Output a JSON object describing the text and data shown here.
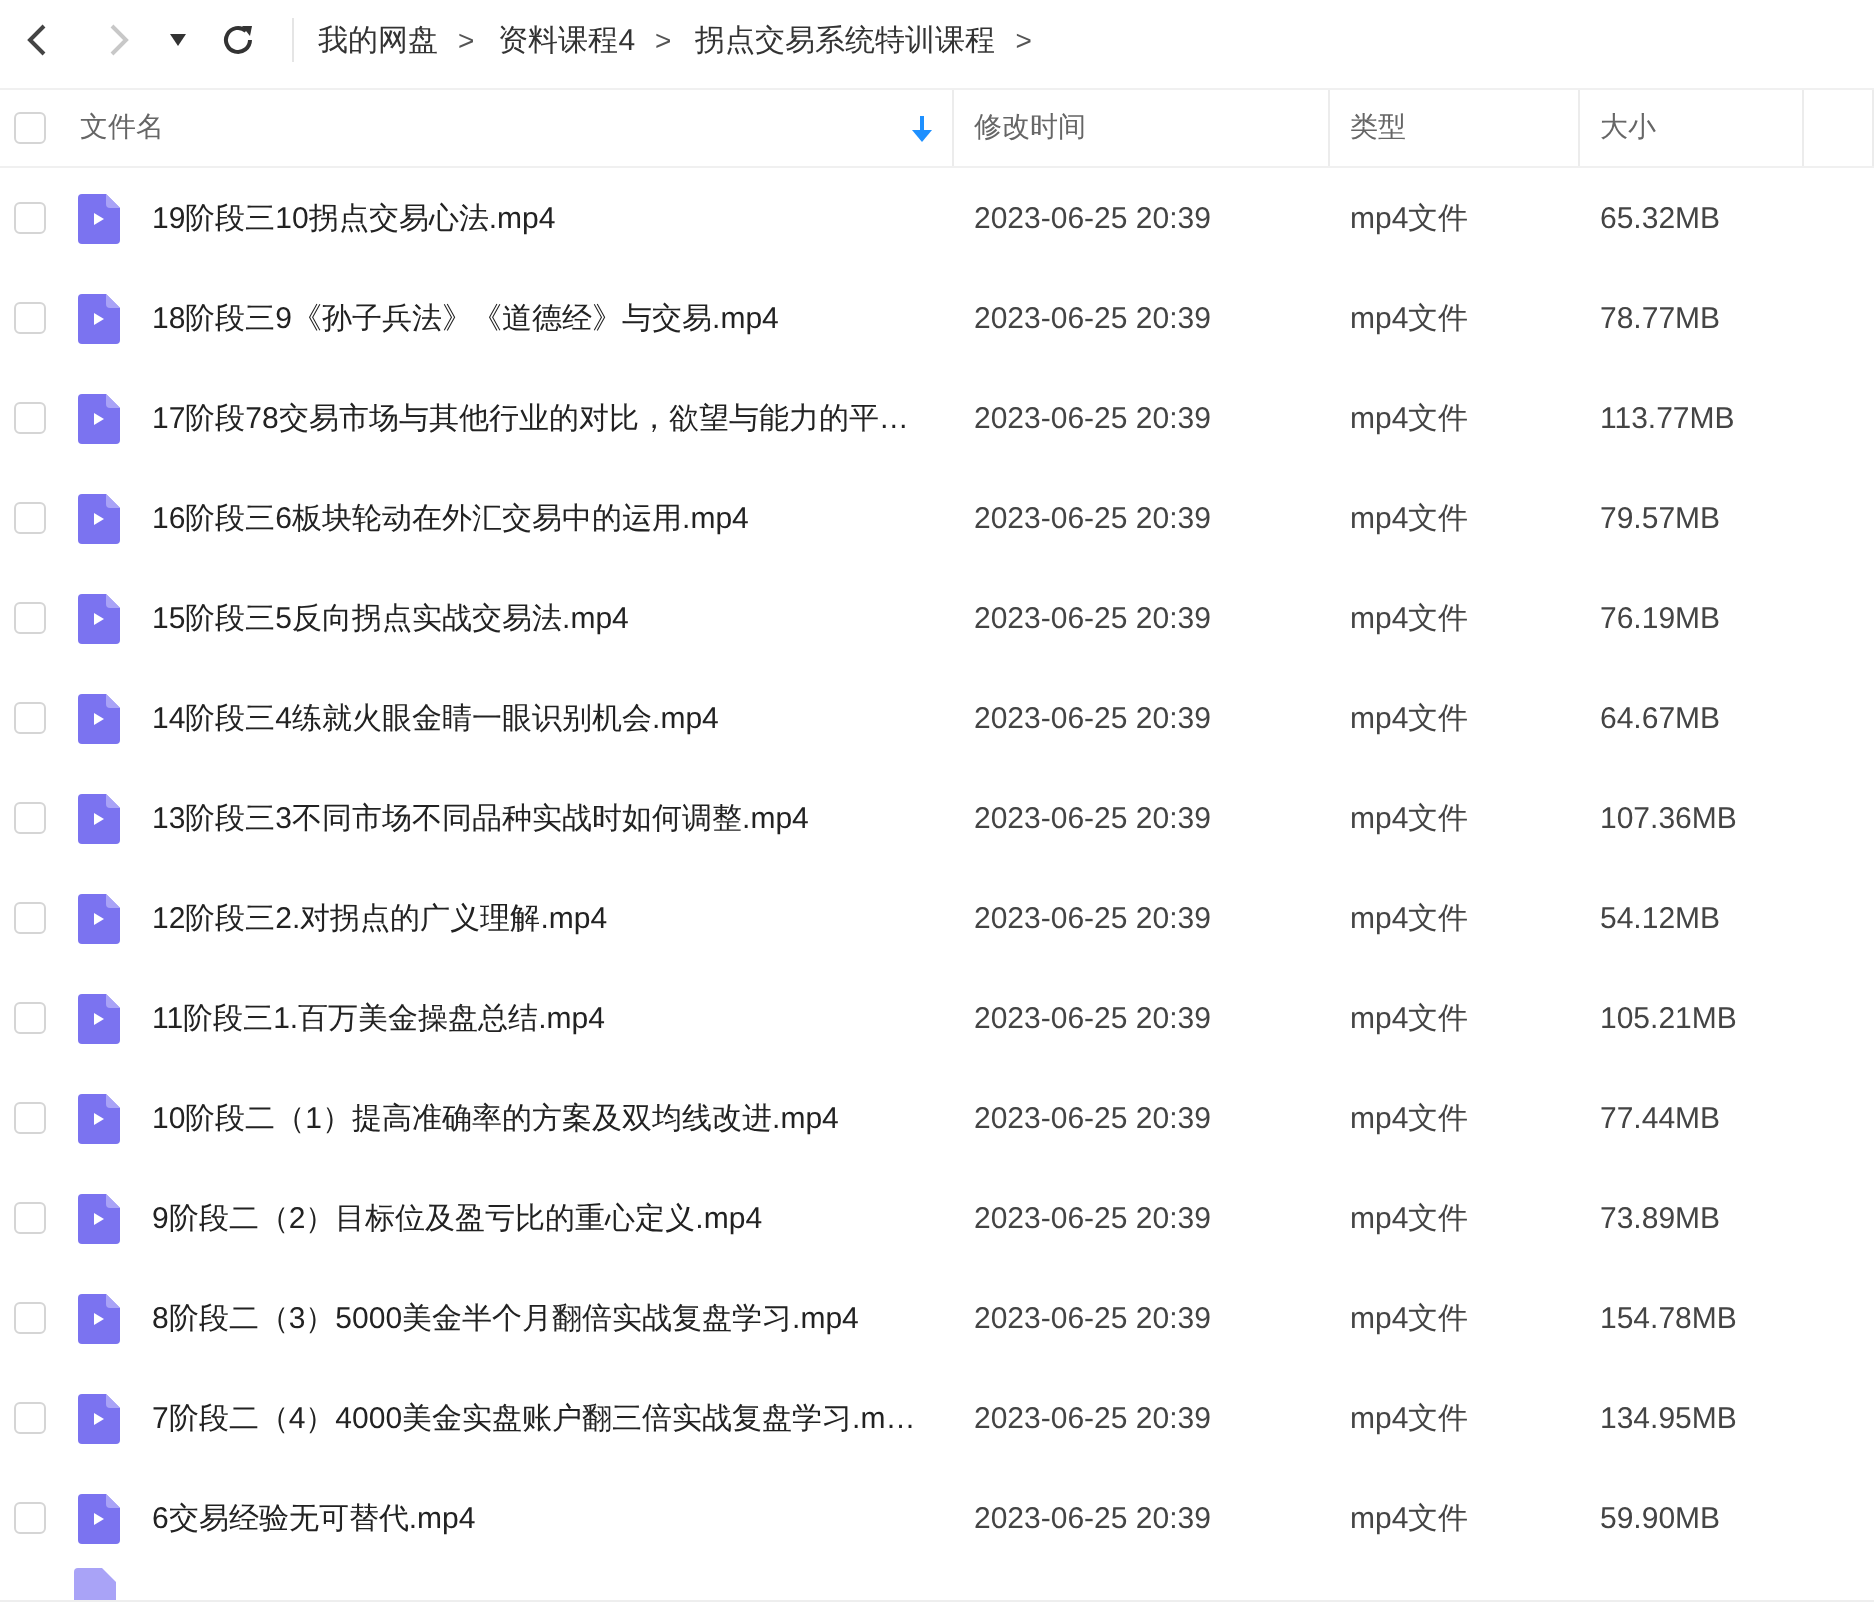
{
  "toolbar": {
    "back": {
      "disabled": false
    },
    "forward": {
      "disabled": true
    },
    "breadcrumb": [
      {
        "label": "我的网盘",
        "sep": ">"
      },
      {
        "label": "资料课程4",
        "sep": ">"
      },
      {
        "label": "拐点交易系统特训课程",
        "sep": ">"
      }
    ]
  },
  "table": {
    "select_all": {
      "checked": false
    },
    "columns": [
      {
        "label": "文件名",
        "sorted": true
      },
      {
        "label": "修改时间",
        "sorted": false
      },
      {
        "label": "类型",
        "sorted": false
      },
      {
        "label": "大小",
        "sorted": false
      }
    ],
    "rows": [
      {
        "name": "19阶段三10拐点交易心法.mp4",
        "modified": "2023-06-25 20:39",
        "type": "mp4文件",
        "size": "65.32MB",
        "selected": false
      },
      {
        "name": "18阶段三9《孙子兵法》《道德经》与交易.mp4",
        "modified": "2023-06-25 20:39",
        "type": "mp4文件",
        "size": "78.77MB",
        "selected": false
      },
      {
        "name": "17阶段78交易市场与其他行业的对比，欲望与能力的平…",
        "modified": "2023-06-25 20:39",
        "type": "mp4文件",
        "size": "113.77MB",
        "selected": false
      },
      {
        "name": "16阶段三6板块轮动在外汇交易中的运用.mp4",
        "modified": "2023-06-25 20:39",
        "type": "mp4文件",
        "size": "79.57MB",
        "selected": false
      },
      {
        "name": "15阶段三5反向拐点实战交易法.mp4",
        "modified": "2023-06-25 20:39",
        "type": "mp4文件",
        "size": "76.19MB",
        "selected": false
      },
      {
        "name": "14阶段三4练就火眼金睛一眼识别机会.mp4",
        "modified": "2023-06-25 20:39",
        "type": "mp4文件",
        "size": "64.67MB",
        "selected": false
      },
      {
        "name": "13阶段三3不同市场不同品种实战时如何调整.mp4",
        "modified": "2023-06-25 20:39",
        "type": "mp4文件",
        "size": "107.36MB",
        "selected": false
      },
      {
        "name": "12阶段三2.对拐点的广义理解.mp4",
        "modified": "2023-06-25 20:39",
        "type": "mp4文件",
        "size": "54.12MB",
        "selected": false
      },
      {
        "name": "11阶段三1.百万美金操盘总结.mp4",
        "modified": "2023-06-25 20:39",
        "type": "mp4文件",
        "size": "105.21MB",
        "selected": false
      },
      {
        "name": "10阶段二（1）提高准确率的方案及双均线改进.mp4",
        "modified": "2023-06-25 20:39",
        "type": "mp4文件",
        "size": "77.44MB",
        "selected": false
      },
      {
        "name": "9阶段二（2）目标位及盈亏比的重心定义.mp4",
        "modified": "2023-06-25 20:39",
        "type": "mp4文件",
        "size": "73.89MB",
        "selected": false
      },
      {
        "name": "8阶段二（3）5000美金半个月翻倍实战复盘学习.mp4",
        "modified": "2023-06-25 20:39",
        "type": "mp4文件",
        "size": "154.78MB",
        "selected": false
      },
      {
        "name": "7阶段二（4）4000美金实盘账户翻三倍实战复盘学习.m…",
        "modified": "2023-06-25 20:39",
        "type": "mp4文件",
        "size": "134.95MB",
        "selected": false
      },
      {
        "name": "6交易经验无可替代.mp4",
        "modified": "2023-06-25 20:39",
        "type": "mp4文件",
        "size": "59.90MB",
        "selected": false
      }
    ]
  }
}
